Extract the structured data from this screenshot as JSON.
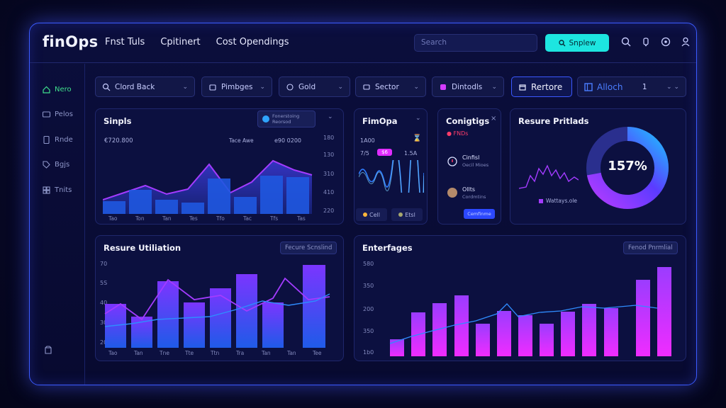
{
  "app": {
    "logo": "finOps",
    "nav": [
      "Fnst Tuls",
      "Cpitinert",
      "Cost Opendings"
    ],
    "search_placeholder": "Search",
    "cta_label": "Snplew"
  },
  "sidebar": {
    "items": [
      {
        "label": "Nero",
        "icon": "home-icon",
        "active": true
      },
      {
        "label": "Pelos",
        "icon": "folder-icon",
        "active": false
      },
      {
        "label": "Rnde",
        "icon": "document-icon",
        "active": false
      },
      {
        "label": "Bgjs",
        "icon": "tag-icon",
        "active": false
      },
      {
        "label": "Tnits",
        "icon": "grid-icon",
        "active": false
      }
    ]
  },
  "filters": [
    {
      "label": "Clord Back",
      "icon": "search-icon"
    },
    {
      "label": "Pimbges",
      "icon": "bag-icon"
    },
    {
      "label": "Gold",
      "icon": "coin-icon"
    },
    {
      "label": "Sector",
      "icon": "stack-icon"
    },
    {
      "label": "Dintodls",
      "icon": "chip-icon"
    }
  ],
  "actions": {
    "restore_label": "Rertore",
    "alloch_label": "Alloch",
    "alloch_value": "1"
  },
  "cards": {
    "signals": {
      "title": "Sinpls",
      "legend_label": "Fonerstoing",
      "legend_sub": "Reorsod",
      "value_left": "€720.800",
      "value_mid": "Tace Awe",
      "value_right": "e90 0200",
      "y_ticks": [
        "180",
        "130",
        "310",
        "410",
        "220"
      ],
      "x_ticks": [
        "Tao",
        "Ton",
        "Tan",
        "Tes",
        "Tfo",
        "Tac",
        "Tfs",
        "Tas"
      ]
    },
    "finops": {
      "title": "FimOpa",
      "stat_a": "1A00",
      "stat_b": "7/5",
      "stat_c": "1.5A",
      "badge": "$6",
      "btn_a": "Cell",
      "btn_b": "Etsl"
    },
    "configs": {
      "title": "Conigtigs",
      "sub": "FNDs",
      "item1_title": "Cinfisl",
      "item1_sub": "Oecil Mioes",
      "item2_title": "Ollts",
      "item2_sub": "Cordmtins",
      "button": "Cemfinme"
    },
    "resource_pricing": {
      "title": "Resure Pritlads",
      "donut_value": "157%",
      "donut_fraction": 0.72,
      "legend": "Wattays.ole"
    },
    "utilization": {
      "title": "Resure Utiliation",
      "tag": "Fecure Scnslind",
      "y_ticks": [
        "70",
        "5S",
        "40",
        "30",
        "20"
      ],
      "x_ticks": [
        "Tao",
        "Tan",
        "Tne",
        "Tte",
        "Ttn",
        "Tra",
        "Tan",
        "Tan",
        "Tee"
      ]
    },
    "enterfages": {
      "title": "Enterfages",
      "tag": "Fenod Pnrmlial",
      "y_ticks": [
        "580",
        "350",
        "200",
        "350",
        "1b0"
      ]
    }
  },
  "colors": {
    "accent_cyan": "#1de5e0",
    "accent_purple": "#a13bff",
    "accent_magenta": "#e02cff",
    "accent_blue": "#3a5bff",
    "active_green": "#3fe08d"
  }
}
